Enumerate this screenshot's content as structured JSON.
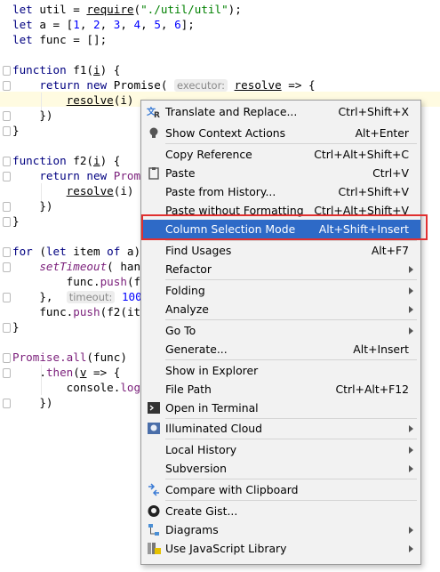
{
  "code_lines": [
    {
      "t": "let util = require(\"./util/util\");"
    },
    {
      "t": "let a = [1, 2, 3, 4, 5, 6];"
    },
    {
      "t": "let func = [];"
    },
    {
      "t": ""
    },
    {
      "t": "function f1(i) {"
    },
    {
      "t": "    return new Promise( executor: resolve => {"
    },
    {
      "t": "        resolve(i)"
    },
    {
      "t": "    })"
    },
    {
      "t": "}"
    },
    {
      "t": ""
    },
    {
      "t": "function f2(i) {"
    },
    {
      "t": "    return new Prom"
    },
    {
      "t": "        resolve(i)"
    },
    {
      "t": "    })"
    },
    {
      "t": "}"
    },
    {
      "t": ""
    },
    {
      "t": "for (let item of a)"
    },
    {
      "t": "    setTimeout( han"
    },
    {
      "t": "        func.push(f"
    },
    {
      "t": "    },  timeout: 100)"
    },
    {
      "t": "    func.push(f2(it"
    },
    {
      "t": "}"
    },
    {
      "t": ""
    },
    {
      "t": "Promise.all(func)"
    },
    {
      "t": "    .then(v => {"
    },
    {
      "t": "        console.log"
    },
    {
      "t": "    })"
    }
  ],
  "editor": {
    "l1_let": "let",
    "l1_rest1": " util = ",
    "l1_require": "require",
    "l1_p": "(",
    "l1_str": "\"./util/util\"",
    "l1_end": ");",
    "l2_let": "let",
    "l2_rest": " a = [",
    "l2_nums": [
      "1",
      "2",
      "3",
      "4",
      "5",
      "6"
    ],
    "l2_end": "];",
    "l3_let": "let",
    "l3_rest": " func = [];",
    "f1_kw": "function",
    "f1_name": " f1(",
    "f1_param": "i",
    "f1_end": ") {",
    "ret_kw": "return new",
    "promise": " Promise(",
    "hint_executor": "executor:",
    "resolve_param": "resolve",
    "arrow": " => {",
    "resolve_call": "resolve",
    "resolve_arg": "(i)",
    "close_paren": "})",
    "close_brace": "}",
    "f2_kw": "function",
    "f2_name": " f2(",
    "f2_param": "i",
    "f2_end": ") {",
    "prom_trunc": " Prom",
    "for_kw": "for",
    "for_rest1": " (",
    "let_kw": "let",
    "for_rest2": " item ",
    "of_kw": "of",
    "for_rest3": " a)",
    "settimeout": "setTimeout",
    "han": "( han",
    "funcpush": "func.",
    "push": "push",
    "funcpush_arg1": "(f",
    "close2": "},",
    "hint_timeout": "timeout:",
    "timeout_val": " 100)",
    "funcpush2_pre": "func.",
    "funcpush2_push": "push",
    "funcpush2_arg": "(f2(it",
    "promise_all": "Promise.",
    "all": "all",
    "all_arg": "(func)",
    "then_pre": ".",
    "then": "then",
    "then_rest1": "(",
    "then_v": "v",
    "then_rest2": " => {",
    "console": "console.",
    "log": "log"
  },
  "context_menu": {
    "items": [
      {
        "label": "Translate and Replace...",
        "shortcut": "Ctrl+Shift+X",
        "icon": "translate-icon"
      },
      {
        "label": "Show Context Actions",
        "shortcut": "Alt+Enter",
        "icon": "lightbulb-icon"
      },
      {
        "label": "Copy Reference",
        "shortcut": "Ctrl+Alt+Shift+C",
        "icon": ""
      },
      {
        "label": "Paste",
        "shortcut": "Ctrl+V",
        "icon": "clipboard-icon"
      },
      {
        "label": "Paste from History...",
        "shortcut": "Ctrl+Shift+V",
        "icon": ""
      },
      {
        "label": "Paste without Formatting",
        "shortcut": "Ctrl+Alt+Shift+V",
        "icon": ""
      },
      {
        "label": "Column Selection Mode",
        "shortcut": "Alt+Shift+Insert",
        "icon": "",
        "selected": true
      },
      {
        "label": "Find Usages",
        "shortcut": "Alt+F7",
        "icon": ""
      },
      {
        "label": "Refactor",
        "shortcut": "",
        "icon": "",
        "submenu": true
      },
      {
        "label": "Folding",
        "shortcut": "",
        "icon": "",
        "submenu": true
      },
      {
        "label": "Analyze",
        "shortcut": "",
        "icon": "",
        "submenu": true
      },
      {
        "label": "Go To",
        "shortcut": "",
        "icon": "",
        "submenu": true
      },
      {
        "label": "Generate...",
        "shortcut": "Alt+Insert",
        "icon": ""
      },
      {
        "label": "Show in Explorer",
        "shortcut": "",
        "icon": ""
      },
      {
        "label": "File Path",
        "shortcut": "Ctrl+Alt+F12",
        "icon": ""
      },
      {
        "label": "Open in Terminal",
        "shortcut": "",
        "icon": "terminal-icon"
      },
      {
        "label": "Illuminated Cloud",
        "shortcut": "",
        "icon": "cloud-icon",
        "submenu": true
      },
      {
        "label": "Local History",
        "shortcut": "",
        "icon": "",
        "submenu": true
      },
      {
        "label": "Subversion",
        "shortcut": "",
        "icon": "",
        "submenu": true
      },
      {
        "label": "Compare with Clipboard",
        "shortcut": "",
        "icon": "compare-icon"
      },
      {
        "label": "Create Gist...",
        "shortcut": "",
        "icon": "github-icon"
      },
      {
        "label": "Diagrams",
        "shortcut": "",
        "icon": "diagram-icon",
        "submenu": true
      },
      {
        "label": "Use JavaScript Library",
        "shortcut": "",
        "icon": "js-library-icon",
        "submenu": true
      }
    ]
  }
}
